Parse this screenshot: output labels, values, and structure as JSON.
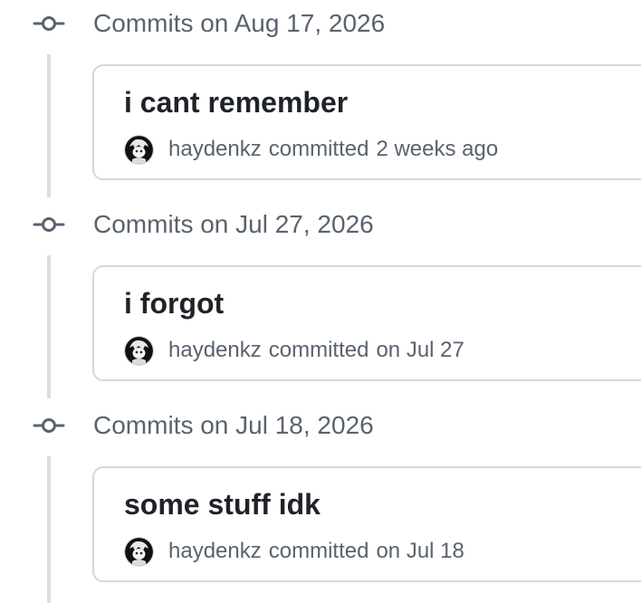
{
  "groups": [
    {
      "title": "Commits on Aug 17, 2026",
      "commit": {
        "message": "i cant remember",
        "author": "haydenkz",
        "action": "committed",
        "time": "2 weeks ago"
      }
    },
    {
      "title": "Commits on Jul 27, 2026",
      "commit": {
        "message": "i forgot",
        "author": "haydenkz",
        "action": "committed",
        "time": "on Jul 27"
      }
    },
    {
      "title": "Commits on Jul 18, 2026",
      "commit": {
        "message": "some stuff idk",
        "author": "haydenkz",
        "action": "committed",
        "time": "on Jul 18"
      }
    }
  ],
  "icons": {
    "group_marker": "git-commit-icon",
    "avatar": "user-avatar"
  },
  "colors": {
    "text_primary": "#1f2328",
    "text_muted": "#59636e",
    "border": "#d1d9e0",
    "timeline": "#d8dee4"
  }
}
